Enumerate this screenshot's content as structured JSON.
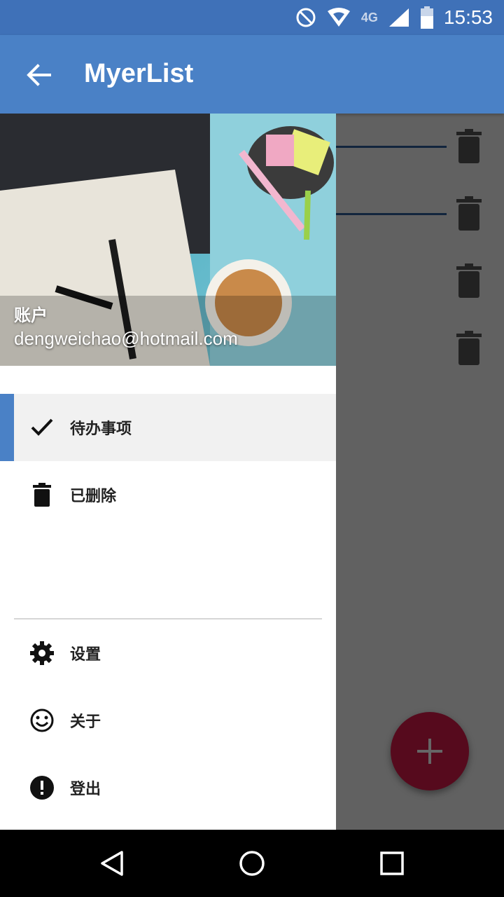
{
  "status_bar": {
    "time": "15:53",
    "network": "4G",
    "icons": [
      "no-disturb-icon",
      "wifi-icon",
      "cellular-signal-icon",
      "battery-icon"
    ]
  },
  "toolbar": {
    "title": "MyerList",
    "back_icon": "arrow-back-icon"
  },
  "drawer": {
    "account_label": "账户",
    "account_email": "dengweichao@hotmail.com",
    "items": [
      {
        "label": "待办事项",
        "icon": "check-icon",
        "selected": true
      },
      {
        "label": "已删除",
        "icon": "trash-icon",
        "selected": false
      }
    ],
    "footer_items": [
      {
        "label": "设置",
        "icon": "gear-icon"
      },
      {
        "label": "关于",
        "icon": "smiley-icon"
      },
      {
        "label": "登出",
        "icon": "exclamation-icon"
      }
    ]
  },
  "fab": {
    "icon": "plus-icon"
  },
  "colors": {
    "primary": "#4a81c6",
    "status_bar": "#3f71b8",
    "accent": "#d81b4a"
  }
}
